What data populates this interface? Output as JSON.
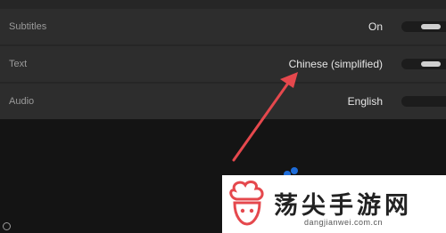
{
  "settings": {
    "rows": [
      {
        "label": "Subtitles",
        "value": "On"
      },
      {
        "label": "Text",
        "value": "Chinese (simplified)"
      },
      {
        "label": "Audio",
        "value": "English"
      }
    ]
  },
  "watermark": {
    "name": "荡尖手游网",
    "url": "dangjianwei.com.cn"
  },
  "colors": {
    "arrow": "#e5484d",
    "accent": "#1e6cd8"
  }
}
